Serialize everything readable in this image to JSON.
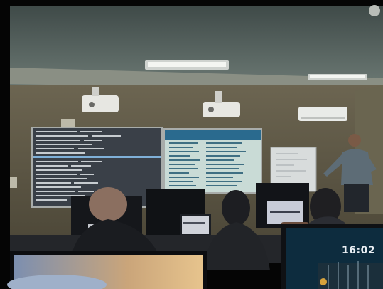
{
  "photo": {
    "monitor_clock": "16:02"
  },
  "colors": {
    "ceiling": "#5d6a63",
    "wall": "#5f5a47",
    "left_screen": "#3a4048",
    "right_screen": "#c9dbd6",
    "right_screen_header": "#2a6a8e",
    "whiteboard": "#d8dcdc"
  }
}
